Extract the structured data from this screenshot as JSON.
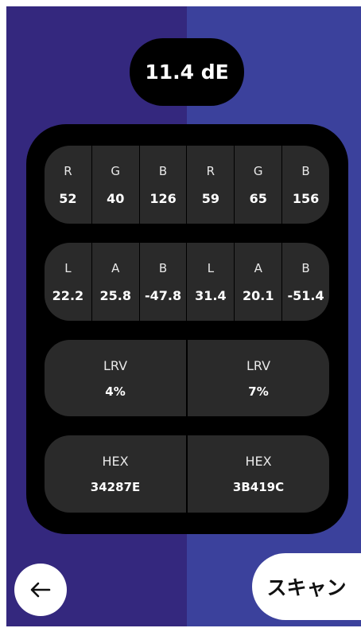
{
  "colors": {
    "left_swatch": "#34287E",
    "right_swatch": "#3B419C",
    "panel": "#000000",
    "pill": "#2a2a2a"
  },
  "delta": {
    "value": "11.4 dE"
  },
  "rgb": {
    "left": [
      {
        "label": "R",
        "value": "52"
      },
      {
        "label": "G",
        "value": "40"
      },
      {
        "label": "B",
        "value": "126"
      }
    ],
    "right": [
      {
        "label": "R",
        "value": "59"
      },
      {
        "label": "G",
        "value": "65"
      },
      {
        "label": "B",
        "value": "156"
      }
    ]
  },
  "lab": {
    "left": [
      {
        "label": "L",
        "value": "22.2"
      },
      {
        "label": "A",
        "value": "25.8"
      },
      {
        "label": "B",
        "value": "-47.8"
      }
    ],
    "right": [
      {
        "label": "L",
        "value": "31.4"
      },
      {
        "label": "A",
        "value": "20.1"
      },
      {
        "label": "B",
        "value": "-51.4"
      }
    ]
  },
  "lrv": {
    "left": {
      "label": "LRV",
      "value": "4%"
    },
    "right": {
      "label": "LRV",
      "value": "7%"
    }
  },
  "hex": {
    "left": {
      "label": "HEX",
      "value": "34287E"
    },
    "right": {
      "label": "HEX",
      "value": "3B419C"
    }
  },
  "actions": {
    "back_icon": "arrow-left-icon",
    "scan_label": "スキャン"
  }
}
